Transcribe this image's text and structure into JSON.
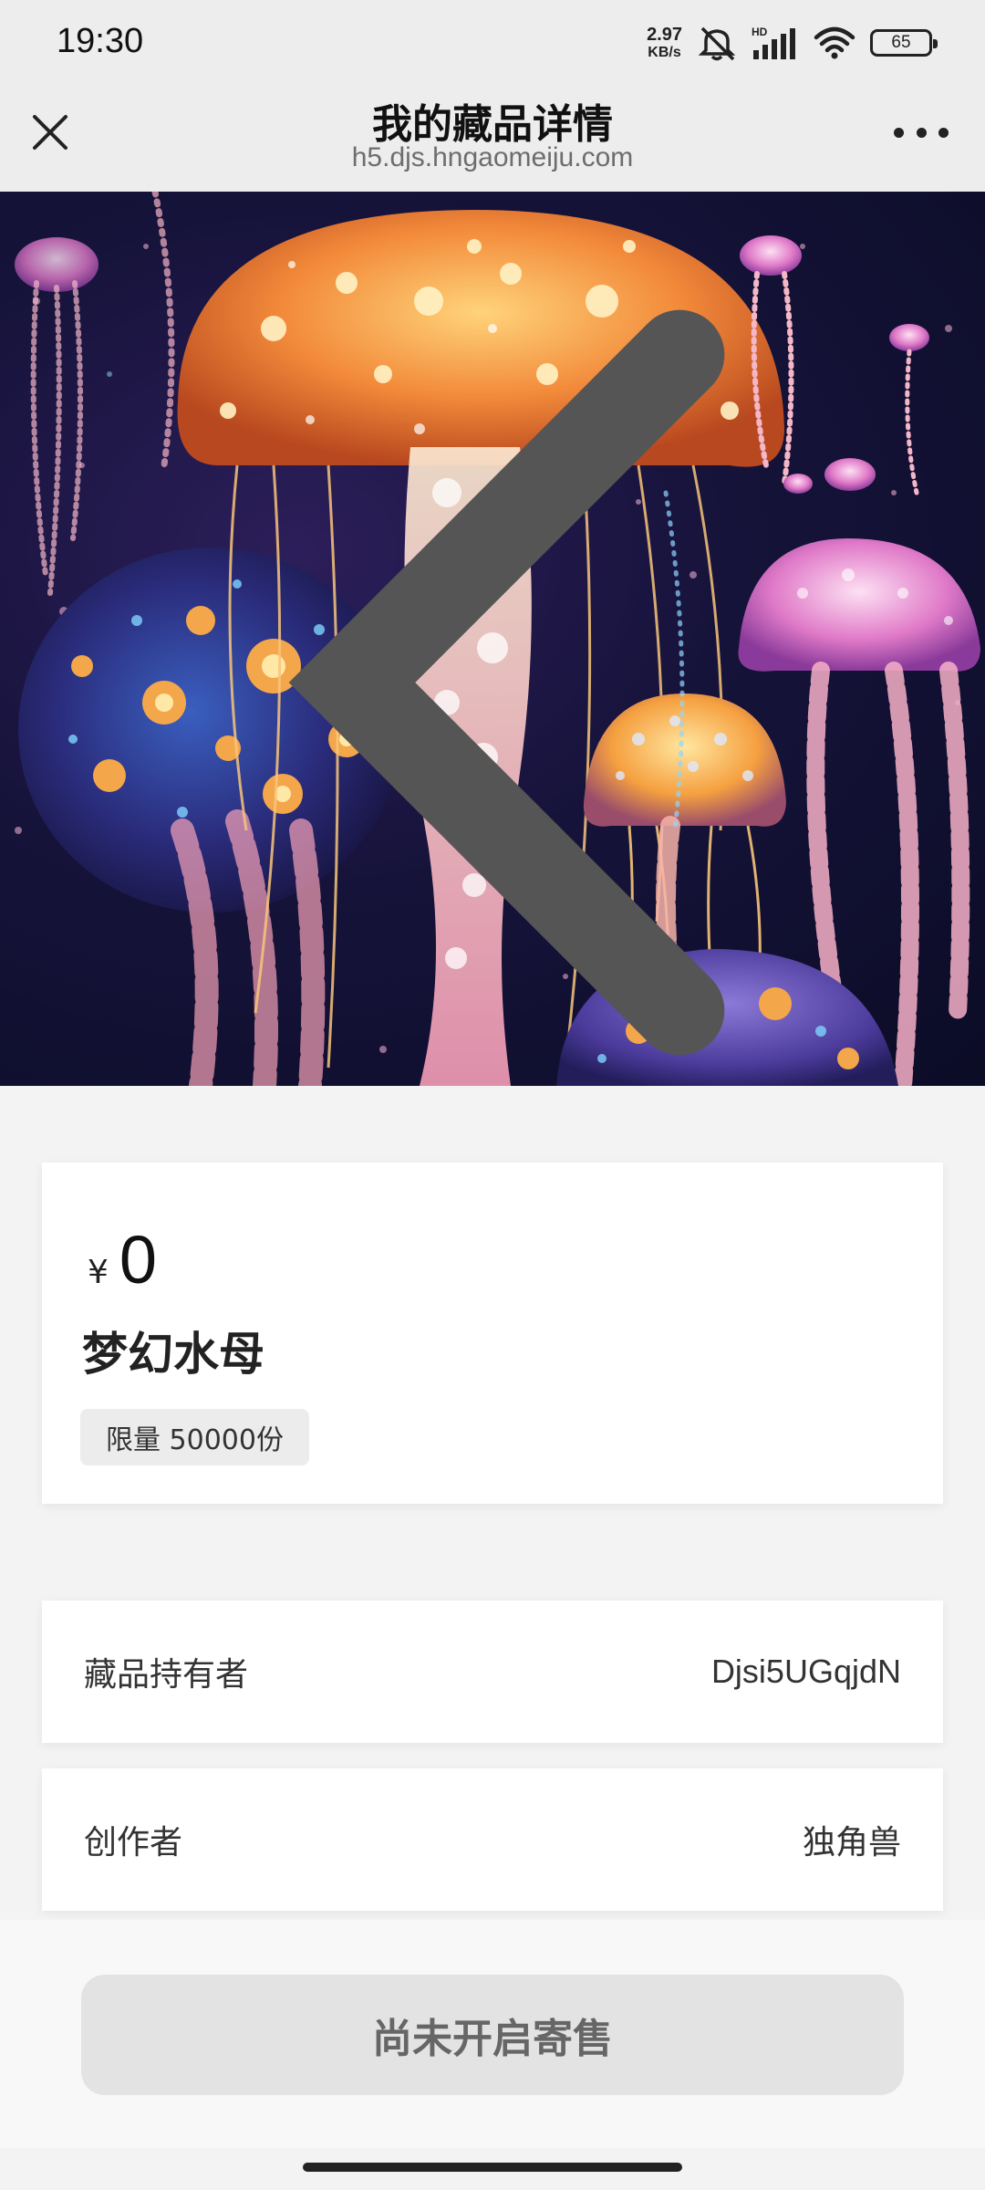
{
  "status_bar": {
    "time": "19:30",
    "net_speed_value": "2.97",
    "net_speed_unit": "KB/s",
    "battery": "65",
    "icons": [
      "mute-icon",
      "hd-signal-icon",
      "wifi-icon",
      "battery-icon"
    ]
  },
  "nav": {
    "title": "我的藏品详情",
    "url": "h5.djs.hngaomeiju.com",
    "close_icon": "close-icon",
    "more_icon": "more-icon"
  },
  "hero": {
    "image": "jellyfish-artwork",
    "back_icon": "back-icon"
  },
  "item": {
    "currency": "¥",
    "price": "0",
    "name": "梦幻水母",
    "limit": "限量 50000份"
  },
  "details": {
    "owner_label": "藏品持有者",
    "owner_value": "Djsi5UGqjdN",
    "creator_label": "创作者",
    "creator_value": "独角兽"
  },
  "actions": {
    "sell_label": "尚未开启寄售"
  },
  "colors": {
    "background": "#f3f3f3",
    "button_bg": "#e3e3e3",
    "button_text": "#666666"
  }
}
